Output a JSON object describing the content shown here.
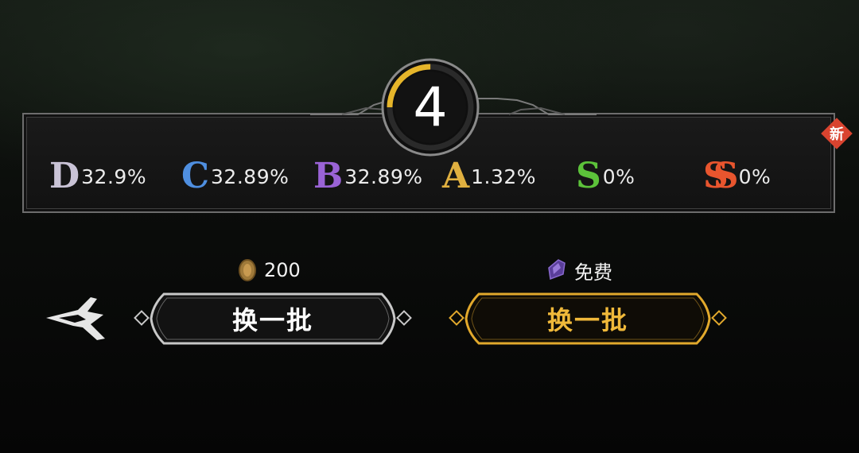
{
  "counter": {
    "value": "4",
    "progress": 0.25,
    "ring_color": "#e6b52a"
  },
  "rates": [
    {
      "grade": "D",
      "value": "32.9%",
      "color": "#c9c3d6"
    },
    {
      "grade": "C",
      "value": "32.89%",
      "color": "#4f8fe0"
    },
    {
      "grade": "B",
      "value": "32.89%",
      "color": "#9a63d6"
    },
    {
      "grade": "A",
      "value": "1.32%",
      "color": "#e0b040"
    },
    {
      "grade": "S",
      "value": "0%",
      "color": "#5cc23a"
    },
    {
      "grade": "SS",
      "value": "0%",
      "color": "#e8552e"
    }
  ],
  "badge": {
    "label": "新",
    "color": "#d9432f"
  },
  "refresh_paid": {
    "cost": "200",
    "cost_icon": "coin-icon",
    "label": "换一批",
    "border_color": "#c8c8c8"
  },
  "refresh_free": {
    "cost": "免费",
    "cost_icon": "crystal-icon",
    "label": "换一批",
    "border_color": "#e2a92c",
    "label_color": "#f0b93a"
  },
  "back": {
    "icon": "back-arrow-icon"
  }
}
